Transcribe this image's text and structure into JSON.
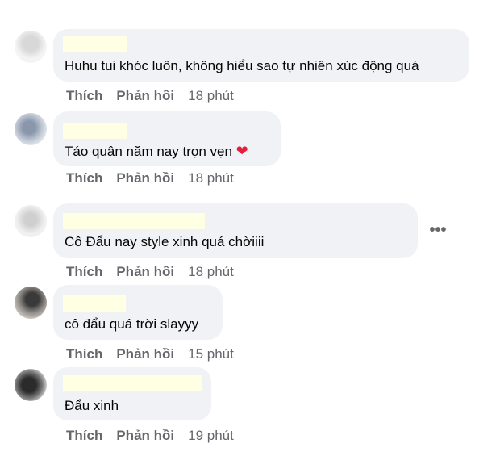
{
  "comments": [
    {
      "text": "Huhu tui khóc luôn, không hiểu sao tự nhiên xúc động quá",
      "like": "Thích",
      "reply": "Phản hồi",
      "time": "18 phút"
    },
    {
      "text": "Táo quân năm nay trọn vẹn",
      "emoji": "heart-emoji",
      "like": "Thích",
      "reply": "Phản hồi",
      "time": "18 phút"
    },
    {
      "text": "Cô Đẩu nay style xinh quá chờiiii",
      "like": "Thích",
      "reply": "Phản hồi",
      "time": "18 phút",
      "more": "•••"
    },
    {
      "text": "cô đẩu quá trời slayyy",
      "like": "Thích",
      "reply": "Phản hồi",
      "time": "15 phút"
    },
    {
      "text": "Đẩu xinh",
      "like": "Thích",
      "reply": "Phản hồi",
      "time": "19 phút"
    }
  ],
  "colors": {
    "bubble": "#f0f2f5",
    "redaction": "#ffffe3",
    "action": "#65676b",
    "heart": "#e41e3f"
  }
}
